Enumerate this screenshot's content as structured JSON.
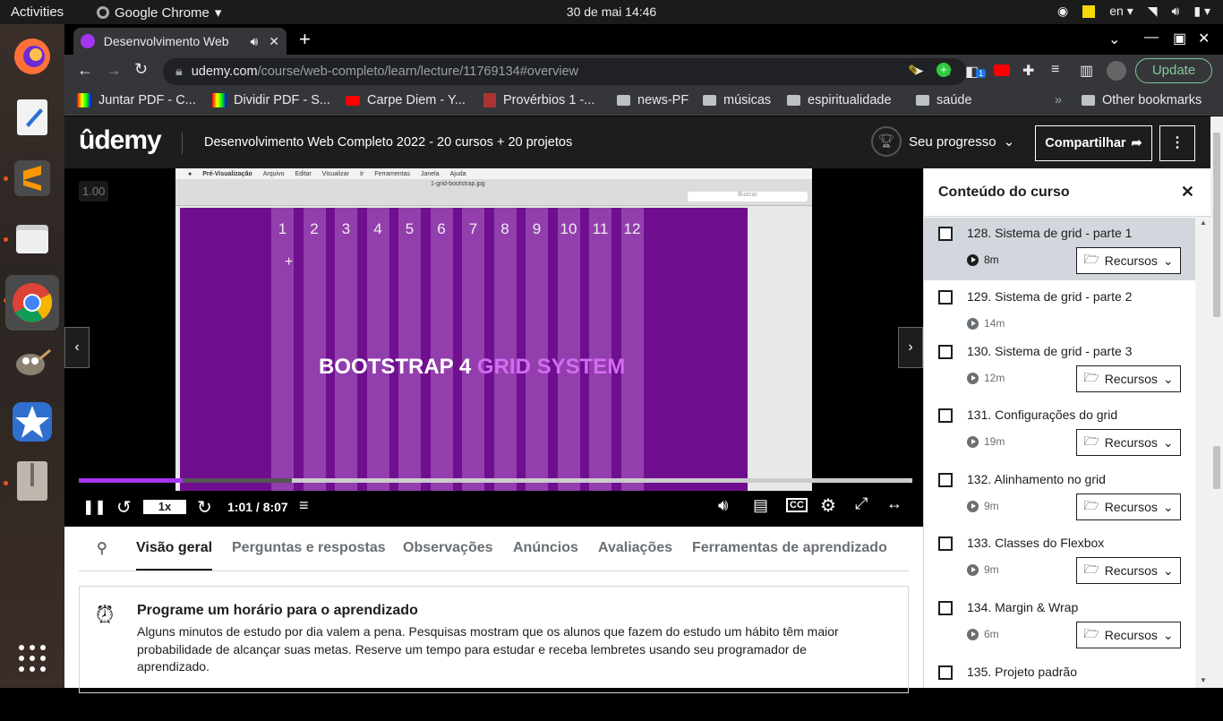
{
  "system": {
    "activities": "Activities",
    "app": "Google Chrome",
    "clock": "30 de mai  14:46",
    "lang": "en"
  },
  "browser": {
    "tab_title": "Desenvolvimento Web",
    "url_host": "udemy.com",
    "url_path": "/course/web-completo/learn/lecture/11769134#overview",
    "update": "Update",
    "bookmarks": [
      "Juntar PDF - C...",
      "Dividir PDF - S...",
      "Carpe Diem - Y...",
      "Provérbios 1 -...",
      "news-PF",
      "músicas",
      "espiritualidade",
      "saúde"
    ],
    "other_bookmarks": "Other bookmarks",
    "ext_badge": "1"
  },
  "header": {
    "course_title": "Desenvolvimento Web Completo 2022 - 20 cursos + 20 projetos",
    "progress": "Seu progresso",
    "share": "Compartilhar"
  },
  "player": {
    "speed_badge": "1.00",
    "slide_text_white": "BOOTSTRAP 4 ",
    "slide_text_pink": "GRID SYSTEM",
    "columns": [
      "1",
      "2",
      "3",
      "4",
      "5",
      "6",
      "7",
      "8",
      "9",
      "10",
      "11",
      "12"
    ],
    "plus": "+",
    "speed": "1x",
    "time": "1:01 / 8:07",
    "progress": 0.125,
    "mac_menu": [
      "Pré-Visualização",
      "Arquivo",
      "Editar",
      "Visualizar",
      "Ir",
      "Ferramentas",
      "Janela",
      "Ajuda"
    ],
    "file_name": "1-grid-bootstrap.jpg",
    "search": "Buscar"
  },
  "tabs": [
    "Visão geral",
    "Perguntas e respostas",
    "Observações",
    "Anúncios",
    "Avaliações",
    "Ferramentas de aprendizado"
  ],
  "reminder": {
    "title": "Programe um horário para o aprendizado",
    "body": "Alguns minutos de estudo por dia valem a pena. Pesquisas mostram que os alunos que fazem do estudo um hábito têm maior probabilidade de alcançar suas metas. Reserve um tempo para estudar e receba lembretes usando seu programador de aprendizado."
  },
  "sidebar": {
    "title": "Conteúdo do curso",
    "resource_label": "Recursos",
    "items": [
      {
        "title": "128. Sistema de grid - parte 1",
        "dur": "8m",
        "res": true
      },
      {
        "title": "129. Sistema de grid - parte 2",
        "dur": "14m",
        "res": false
      },
      {
        "title": "130. Sistema de grid - parte 3",
        "dur": "12m",
        "res": true
      },
      {
        "title": "131. Configurações do grid",
        "dur": "19m",
        "res": true
      },
      {
        "title": "132. Alinhamento no grid",
        "dur": "9m",
        "res": true
      },
      {
        "title": "133. Classes do Flexbox",
        "dur": "9m",
        "res": true
      },
      {
        "title": "134. Margin & Wrap",
        "dur": "6m",
        "res": true
      },
      {
        "title": "135. Projeto padrão",
        "dur": "",
        "res": false
      }
    ]
  }
}
